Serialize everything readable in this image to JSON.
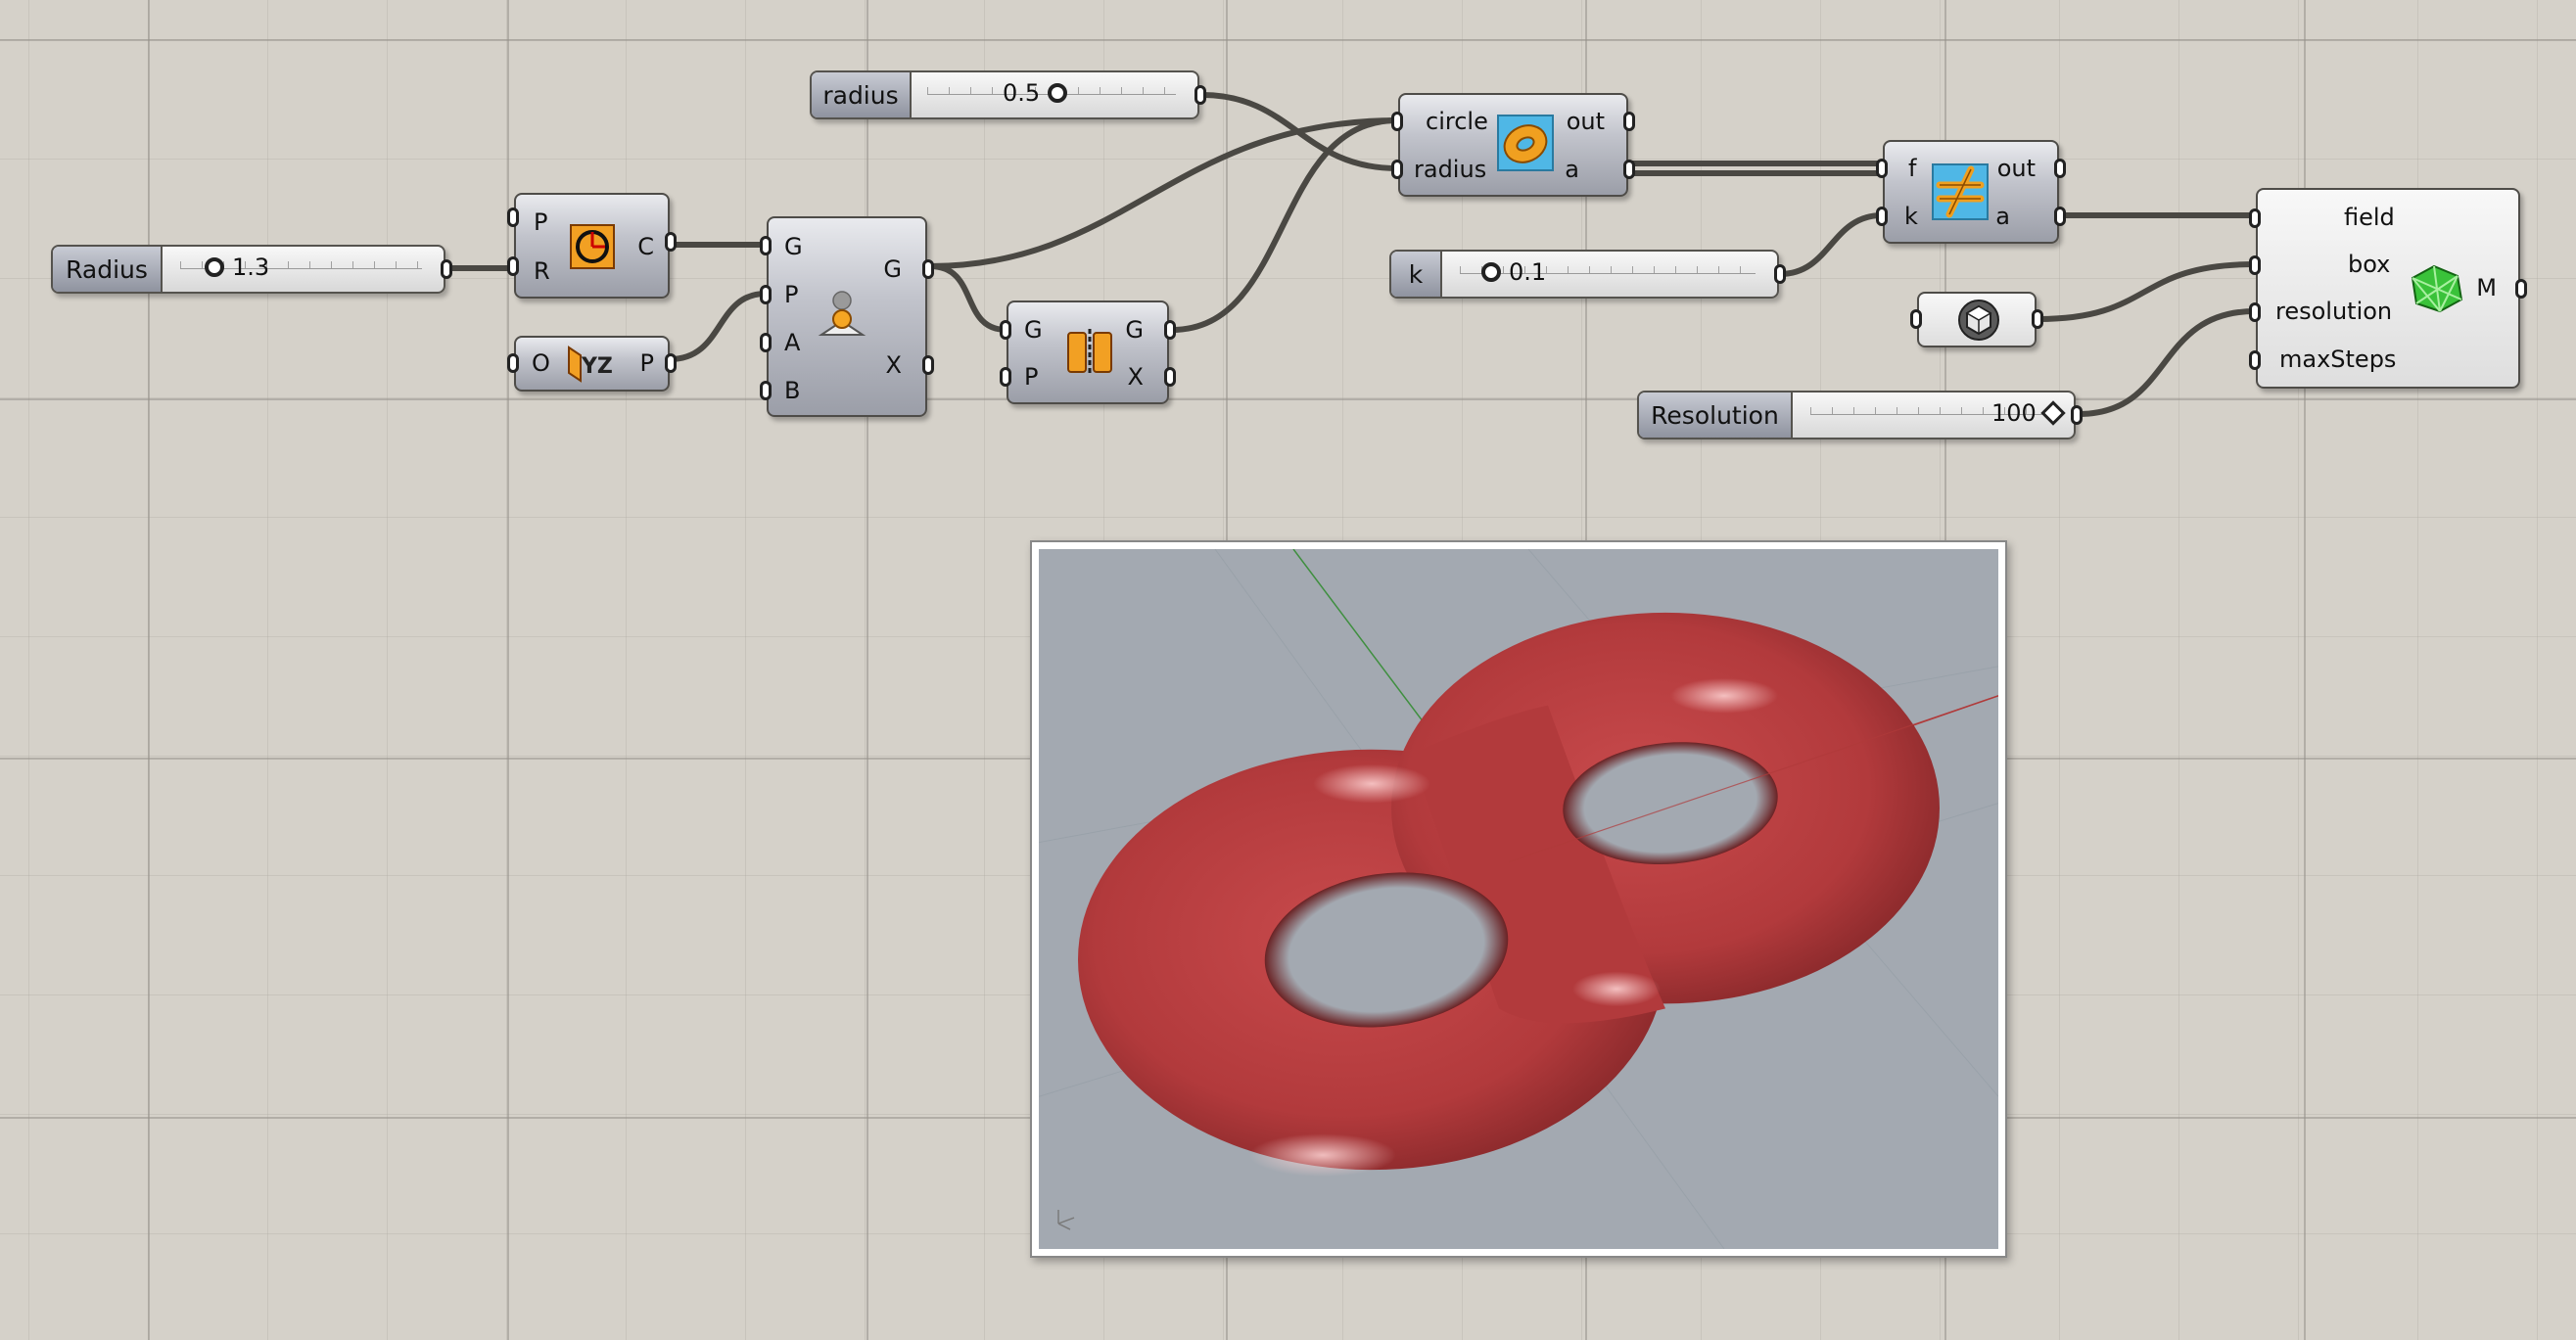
{
  "sliders": {
    "radius_small": {
      "label": "radius",
      "value": "0.5"
    },
    "radius_big": {
      "label": "Radius",
      "value": "1.3"
    },
    "k": {
      "label": "k",
      "value": "0.1"
    },
    "resolution": {
      "label": "Resolution",
      "value": "100"
    }
  },
  "components": {
    "circle": {
      "inputs": [
        "P",
        "R"
      ],
      "outputs": [
        "C"
      ],
      "icon": "circle-icon"
    },
    "yz_plane": {
      "inputs": [
        "O"
      ],
      "outputs": [
        "P"
      ],
      "icon": "yz-plane-icon"
    },
    "orient": {
      "inputs": [
        "G",
        "P",
        "A",
        "B"
      ],
      "outputs": [
        "G",
        "X"
      ],
      "icon": "orient-icon"
    },
    "mirror": {
      "inputs": [
        "G",
        "P"
      ],
      "outputs": [
        "G",
        "X"
      ],
      "icon": "mirror-icon"
    },
    "torus_field": {
      "inputs": [
        "circle",
        "radius"
      ],
      "outputs": [
        "out",
        "a"
      ],
      "icon": "torus-icon"
    },
    "smooth_union": {
      "inputs": [
        "f",
        "k"
      ],
      "outputs": [
        "out",
        "a"
      ],
      "icon": "smooth-union-icon"
    },
    "box": {
      "icon": "box-icon"
    },
    "mesher": {
      "inputs": [
        "field",
        "box",
        "resolution",
        "maxSteps"
      ],
      "outputs": [
        "M"
      ],
      "icon": "mesh-icon"
    }
  },
  "viewport": {
    "content": "double-torus-render",
    "background": "#a3a9b1",
    "surface_color": "#b23a3c"
  },
  "colors": {
    "canvas": "#d5d1c9",
    "wire": "#4a4843",
    "node": "#b9bbc3"
  }
}
